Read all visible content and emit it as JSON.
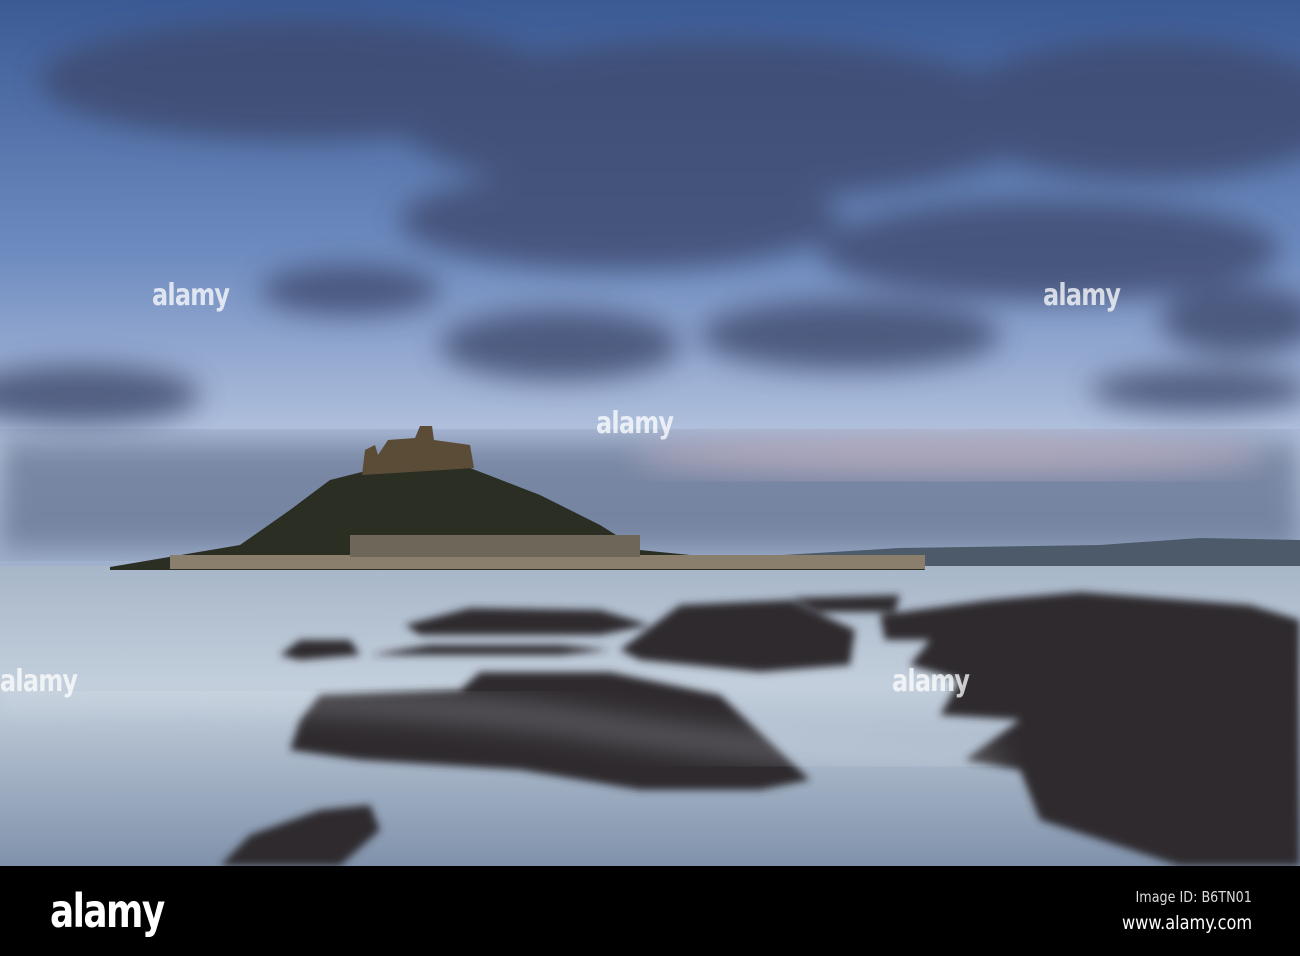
{
  "watermark": {
    "text": "alamy"
  },
  "footer": {
    "logo": "alamy",
    "image_id": "Image ID: B6TN01",
    "website": "www.alamy.com"
  },
  "colors": {
    "sky_top": "#3c5a93",
    "sky_horizon": "#c6d3e6",
    "sea": "#b9c6d6",
    "rock": "#2e2c30",
    "footer": "#000000"
  }
}
